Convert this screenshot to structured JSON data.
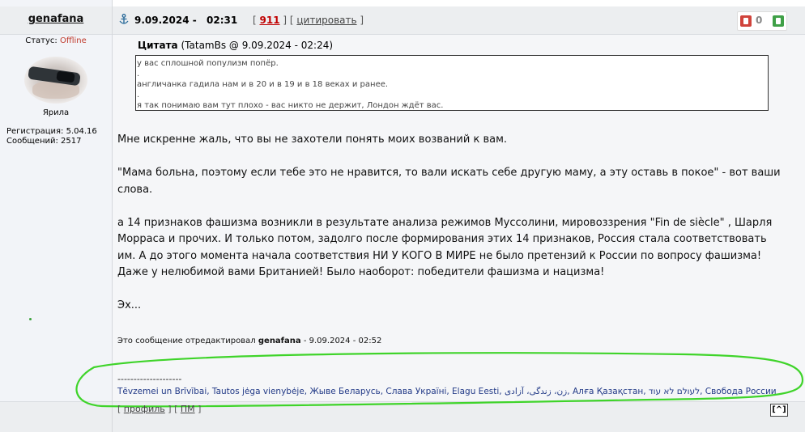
{
  "user": {
    "name": "genafana",
    "status_label": "Статус:",
    "status_value": "Offline",
    "rank": "Ярила",
    "registration": "Регистрация: 5.04.16",
    "messages": "Сообщений: 2517"
  },
  "header": {
    "date": "9.09.2024",
    "time_sep": "-",
    "time": "02:31",
    "post_number": "911",
    "cite_label": "цитировать",
    "rating_value": "0"
  },
  "quote": {
    "label": "Цитата",
    "source": "(TatamBs @ 9.09.2024 - 02:24)",
    "lines": [
      "у вас сплошной популизм попёр.",
      ".",
      "англичанка гадила нам и в 20 и в 19 и в 18 веках и ранее.",
      ".",
      "я так понимаю вам тут плохо - вас никто не держит, Лондон ждёт вас."
    ]
  },
  "body": {
    "paragraphs": [
      "Мне искренне жаль, что вы не захотели понять моих возваний к вам.",
      "\"Мама больна, поэтому если тебе это не нравится, то вали искать себе другую маму, а эту оставь в покое\" - вот ваши слова.",
      "а 14 признаков фашизма возникли в результате анализа режимов Муссолини, мировоззрения \"Fin de siècle\" , Шарля Морраса и прочих. И только потом, задолго после формирования этих 14 признаков, Россия стала соответствовать им. А до этого момента начала соответствия НИ У КОГО В МИРЕ не было претензий к России по вопросу фашизма! Даже у нелюбимой вами Британией! Было наоборот: победители фашизма и нацизма!",
      "Эх..."
    ]
  },
  "edited": {
    "prefix": "Это сообщение отредактировал",
    "author": "genafana",
    "suffix": "- 9.09.2024 - 02:52"
  },
  "signature": {
    "divider": "--------------------",
    "text": "Tēvzemei un Brīvībai, Tautos jėga vienybėje, Жыве Беларусь, Слава Україні, Elagu Eesti, زن، زندگی، آزادی, Алға Қазақстан, לעולם לא עוד, Свобода России"
  },
  "footer": {
    "profile_label": "профиль",
    "pm_label": "ПМ",
    "up_label": "[^]"
  },
  "colors": {
    "status_offline": "#c0392b",
    "post_number": "#c00000",
    "signature_link": "#223a87",
    "highlight_ellipse": "#3fd42a"
  }
}
